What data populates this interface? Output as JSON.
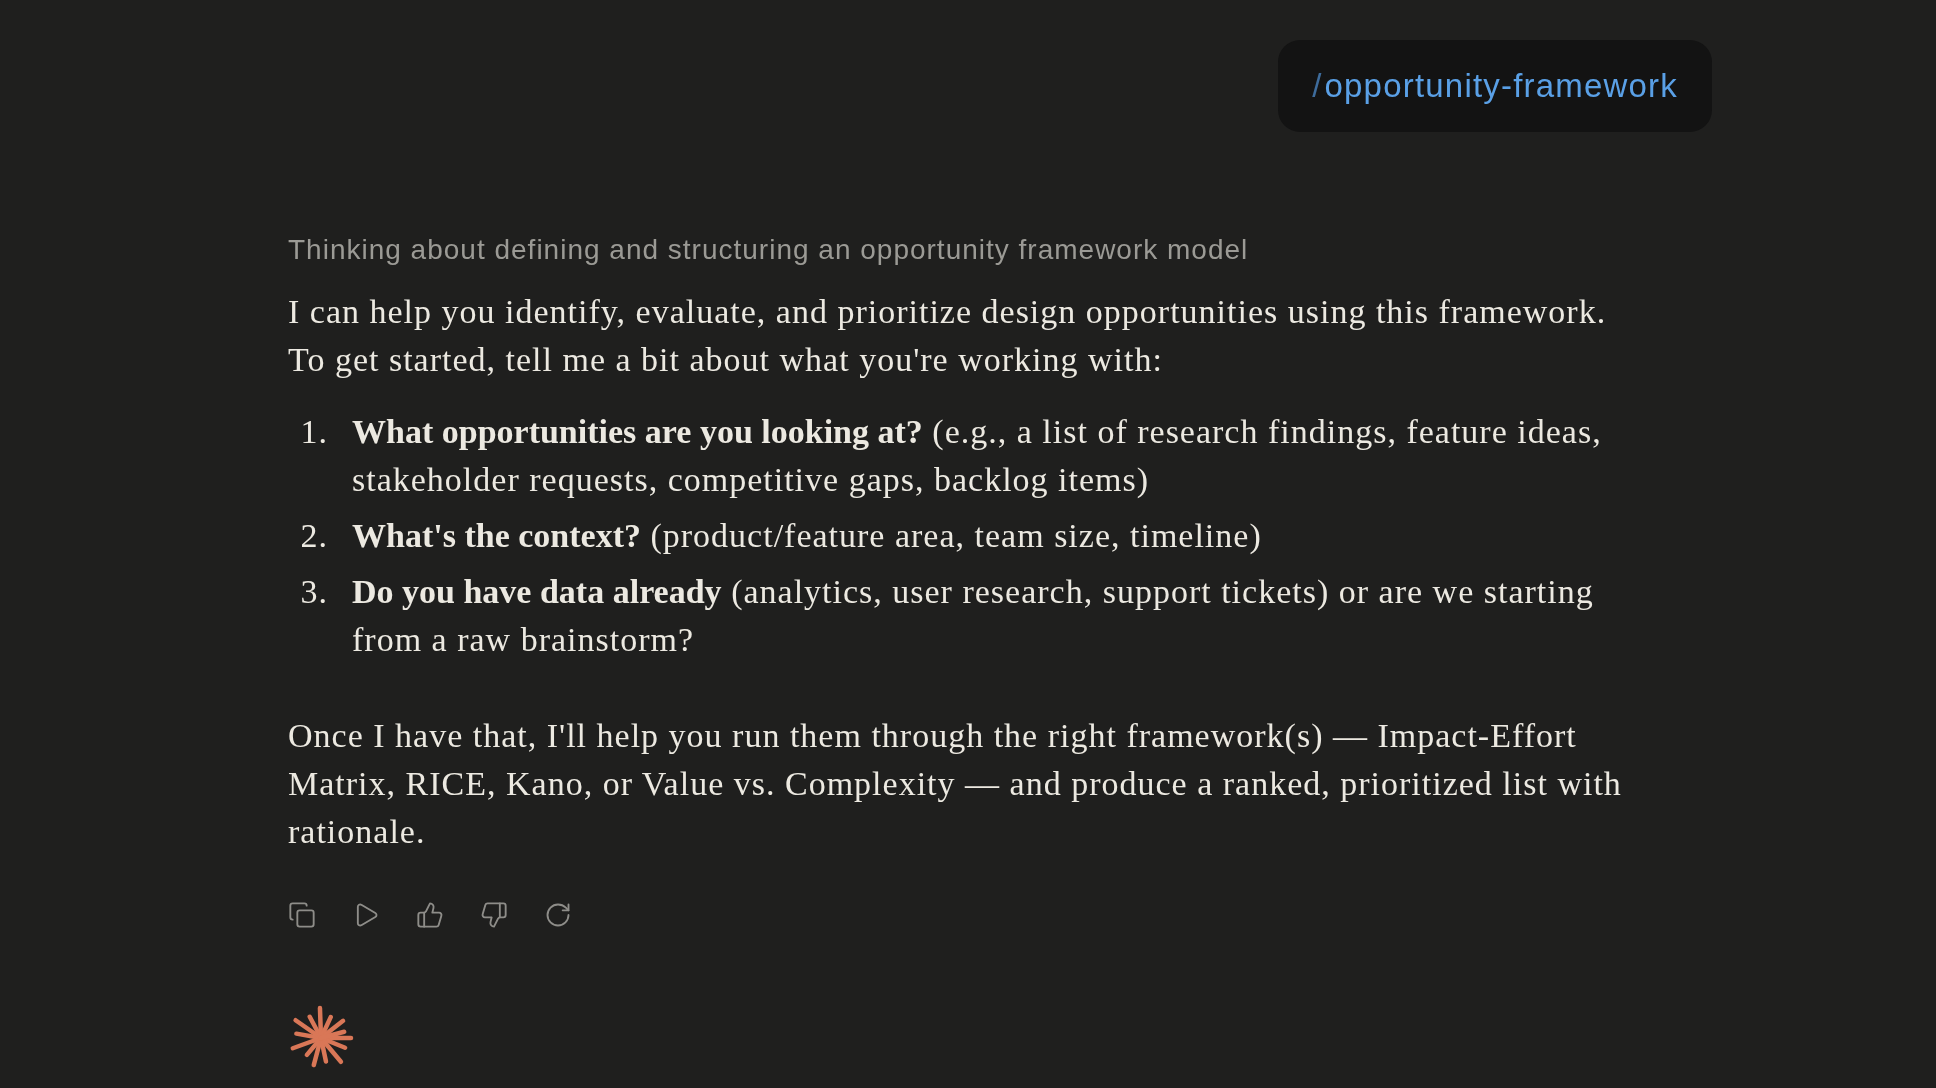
{
  "user_message": {
    "prefix": "/",
    "command": "opportunity-framework"
  },
  "response": {
    "thinking": "Thinking about defining and structuring an opportunity framework model",
    "intro": "I can help you identify, evaluate, and prioritize design opportunities using this framework. To get started, tell me a bit about what you're working with:",
    "questions": [
      {
        "number": "1.",
        "text": "**What opportunities are you looking at?** (e.g., a list of research findings, feature ideas, stakeholder requests, competitive gaps, backlog items)"
      },
      {
        "number": "2.",
        "text": "**What's the context?** (product/feature area, team size, timeline)"
      },
      {
        "number": "3.",
        "text": "**Do you have data already** (analytics, user research, support tickets) or are we starting from a raw brainstorm?"
      }
    ],
    "closing": "Once I have that, I'll help you run them through the right framework(s) — Impact-Effort Matrix, RICE, Kano, or Value vs. Complexity — and produce a ranked, prioritized list with rationale."
  }
}
